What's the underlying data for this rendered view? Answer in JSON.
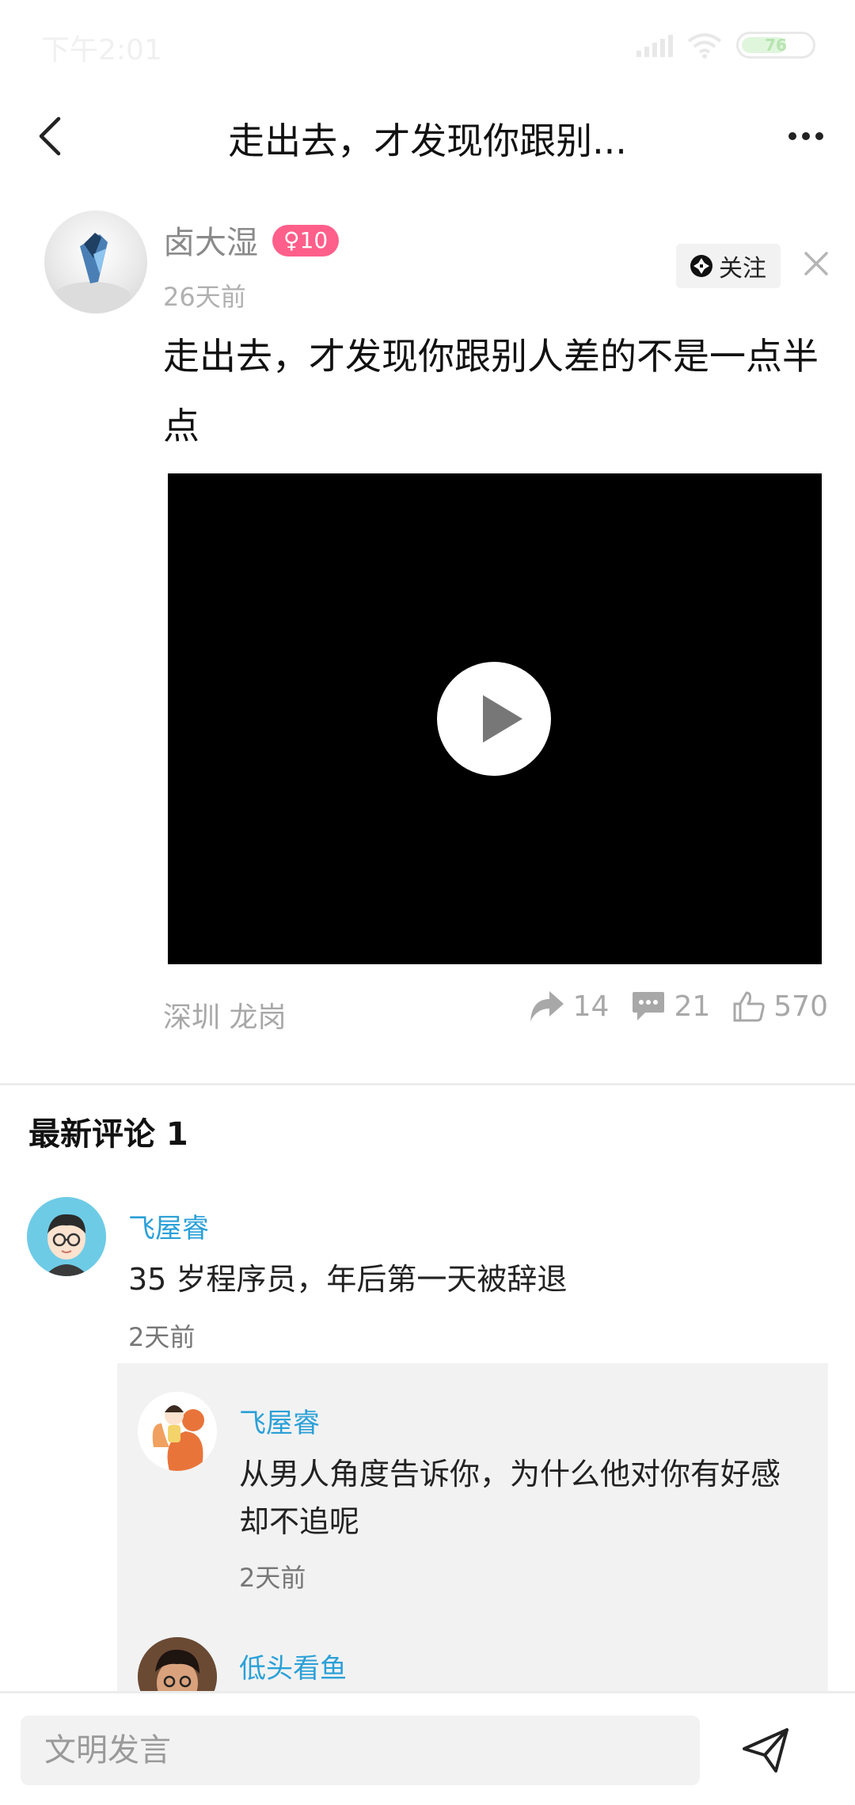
{
  "status_bar": {
    "time": "下午2:01",
    "battery": "76"
  },
  "nav": {
    "title": "走出去，才发现你跟别..."
  },
  "post": {
    "author_name": "卤大湿",
    "level_badge": "♀10",
    "time": "26天前",
    "follow_label": "关注",
    "text": "走出去，才发现你跟别人差的不是一点半点",
    "location": "深圳 龙岗",
    "stats": {
      "shares": "14",
      "comments": "21",
      "likes": "570"
    }
  },
  "comments": {
    "heading": "最新评论 1",
    "items": [
      {
        "name": "飞屋睿",
        "text": "35 岁程序员，年后第一天被辞退",
        "time": "2天前",
        "replies": [
          {
            "name": "飞屋睿",
            "text": "从男人角度告诉你，为什么他对你有好感却不追呢",
            "time": "2天前"
          },
          {
            "name": "低头看鱼"
          }
        ]
      }
    ]
  },
  "bottom_bar": {
    "input_placeholder": "文明发言"
  },
  "colors": {
    "accent_name": "#2aa0d8",
    "level_badge": "#ff5f8a",
    "video_bg": "#000000"
  },
  "icons": {
    "back": "chevron-left-icon",
    "more": "more-dots-icon",
    "share": "share-arrow-icon",
    "comment": "comment-bubble-icon",
    "like": "thumbs-up-icon",
    "play": "play-icon",
    "send": "send-plane-icon",
    "close": "close-icon"
  }
}
